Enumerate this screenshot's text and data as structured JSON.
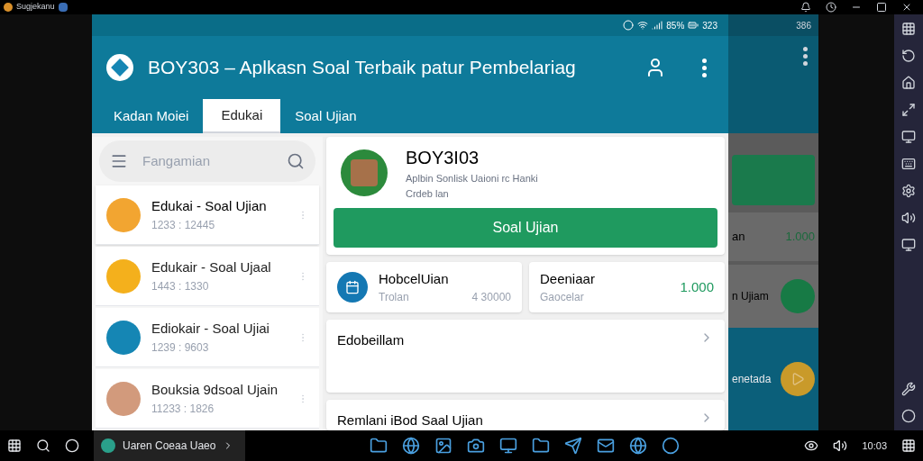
{
  "host_window": {
    "title": "Sugjekanu"
  },
  "status_bar": {
    "battery": "85%",
    "time": "323"
  },
  "app_bar": {
    "title": "BOY303 – Aplkasn Soal Terbaik patur Pembelariag"
  },
  "tabs": [
    {
      "label": "Kadan Moiei",
      "selected": false
    },
    {
      "label": "Edukai",
      "selected": true
    },
    {
      "label": "Soal Ujian",
      "selected": false
    }
  ],
  "search": {
    "placeholder": "Fangamian"
  },
  "list": [
    {
      "title": "Edukai - Soal Ujian",
      "subtitle": "1233 : 12445",
      "color": "#f2a531",
      "selected": true
    },
    {
      "title": "Edukair - Soal Ujaal",
      "subtitle": "1443 : 1330",
      "color": "#f4b01c",
      "selected": false
    },
    {
      "title": "Ediokair - Soal Ujiai",
      "subtitle": "1239 : 9603",
      "color": "#1586b4",
      "selected": false
    },
    {
      "title": "Bouksia 9dsoal Ujain",
      "subtitle": "11233 : 1826",
      "color": "#d29a7c",
      "selected": false
    }
  ],
  "profile": {
    "name": "BOY3I03",
    "line_1": "Aplbin Sonlisk Uaioni rc Hanki",
    "line_2": "Crdeb lan",
    "button": "Soal Ujian"
  },
  "stats": [
    {
      "title": "HobcelUian",
      "label": "Trolan",
      "value": "4 30000"
    },
    {
      "title": "Deeniaar",
      "label": "Gaocelar",
      "value": "1.000"
    }
  ],
  "sections": [
    {
      "title": "Edobeillam"
    },
    {
      "title": "Remlani iBod Saal Ujian"
    }
  ],
  "background_app": {
    "time": "386",
    "stat_title": "an",
    "stat_value": "1.000",
    "row_title": "n Ujiam",
    "banner": "enetada"
  },
  "taskbar": {
    "app_button": "Uaren Coeaa Uaeo",
    "clock": "10:03"
  }
}
